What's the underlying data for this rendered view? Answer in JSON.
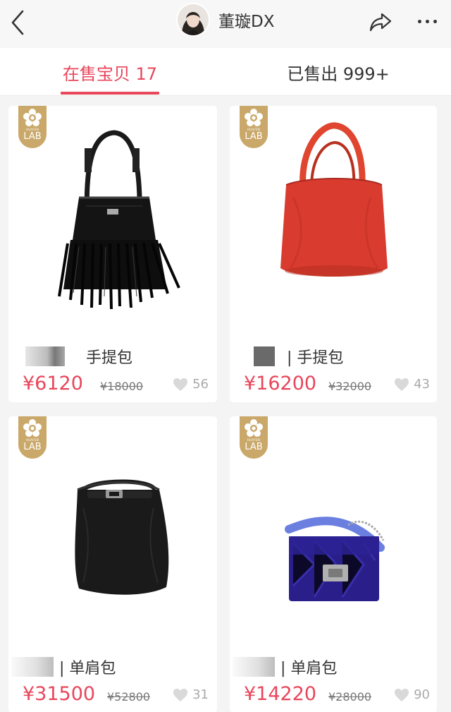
{
  "header": {
    "shop_name": "董璇DX"
  },
  "tabs": [
    {
      "label": "在售宝贝 17",
      "active": true
    },
    {
      "label": "已售出 999+",
      "active": false
    }
  ],
  "badge": {
    "small_text": "HUAFEN",
    "main_text": "LAB"
  },
  "products": [
    {
      "title": "手提包",
      "price": "¥6120",
      "original_price": "¥18000",
      "likes": "56",
      "image": "black-fringe-bucket-bag"
    },
    {
      "title": " | 手提包",
      "price": "¥16200",
      "original_price": "¥32000",
      "likes": "43",
      "image": "red-leather-tote"
    },
    {
      "title": "| 单肩包",
      "price": "¥31500",
      "original_price": "¥52800",
      "likes": "31",
      "image": "black-leather-bucket-bag"
    },
    {
      "title": "| 单肩包",
      "price": "¥14220",
      "original_price": "¥28000",
      "likes": "90",
      "image": "blue-velvet-flap-bag"
    }
  ],
  "colors": {
    "accent": "#e8465b",
    "badge": "#c9a86a"
  }
}
